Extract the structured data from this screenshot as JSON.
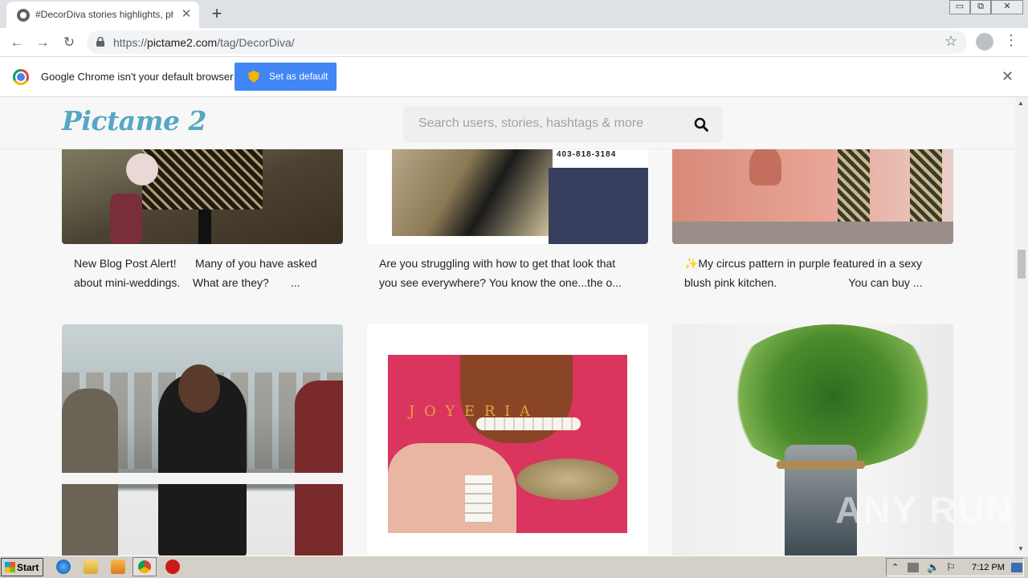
{
  "browser": {
    "tab_title": "#DecorDiva stories highlights, photos",
    "tab_close": "✕",
    "new_tab": "+",
    "url_prefix": "https://",
    "url_domain": "pictame2.com",
    "url_path": "/tag/DecorDiva/",
    "window_minimize": "▭",
    "window_restore": "⧉",
    "window_close": "✕"
  },
  "infobar": {
    "message": "Google Chrome isn't your default browser",
    "button_label": "Set as default",
    "close": "✕"
  },
  "site": {
    "logo": "Pictame 2",
    "search_placeholder": "Search users, stories, hashtags & more"
  },
  "posts_row1": [
    {
      "caption": "New Blog Post Alert!      Many of you have asked\nabout mini-weddings.    What are they?       ..."
    },
    {
      "caption": "Are you struggling with how to get that look that\nyou see everywhere? You know the one...the o..."
    },
    {
      "caption": "✨My circus pattern in purple featured in a sexy\nblush pink kitchen.                       You can buy ..."
    }
  ],
  "posts_row2": [
    {
      "overlay": ""
    },
    {
      "overlay": "J O Y E R I A"
    },
    {
      "overlay": ""
    }
  ],
  "card2_phone": "403-818-3184",
  "watermark": "ANY RUN",
  "taskbar": {
    "start_label": "Start",
    "clock": "7:12 PM"
  }
}
